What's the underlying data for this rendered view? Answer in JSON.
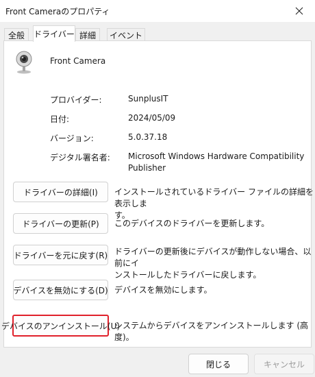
{
  "window": {
    "title": "Front Cameraのプロパティ"
  },
  "tabs": [
    {
      "label": "全般"
    },
    {
      "label": "ドライバー"
    },
    {
      "label": "詳細"
    },
    {
      "label": "イベント"
    }
  ],
  "device": {
    "name": "Front Camera",
    "icon": "webcam-icon"
  },
  "info": [
    {
      "label": "プロバイダー:",
      "value": "SunplusIT"
    },
    {
      "label": "日付:",
      "value": "2024/05/09"
    },
    {
      "label": "バージョン:",
      "value": "5.0.37.18"
    },
    {
      "label": "デジタル署名者:",
      "value_line1": "Microsoft Windows Hardware Compatibility",
      "value_line2": "Publisher"
    }
  ],
  "actions": [
    {
      "button": "ドライバーの詳細(I)",
      "desc_line1": "インストールされているドライバー ファイルの詳細を表示しま",
      "desc_line2": "す。"
    },
    {
      "button": "ドライバーの更新(P)",
      "desc_line1": "このデバイスのドライバーを更新します。"
    },
    {
      "button": "ドライバーを元に戻す(R)",
      "desc_line1": "ドライバーの更新後にデバイスが動作しない場合、以前にイ",
      "desc_line2": "ンストールしたドライバーに戻します。"
    },
    {
      "button": "デバイスを無効にする(D)",
      "desc_line1": "デバイスを無効にします。"
    },
    {
      "button": "デバイスのアンインストール(U)",
      "desc_line1": "システムからデバイスをアンインストールします (高度)。"
    }
  ],
  "footer": {
    "close_label": "閉じる",
    "cancel_label": "キャンセル"
  },
  "colors": {
    "highlight_border": "#e0202a",
    "panel": "#ffffff",
    "chrome": "#f0f0f0"
  }
}
